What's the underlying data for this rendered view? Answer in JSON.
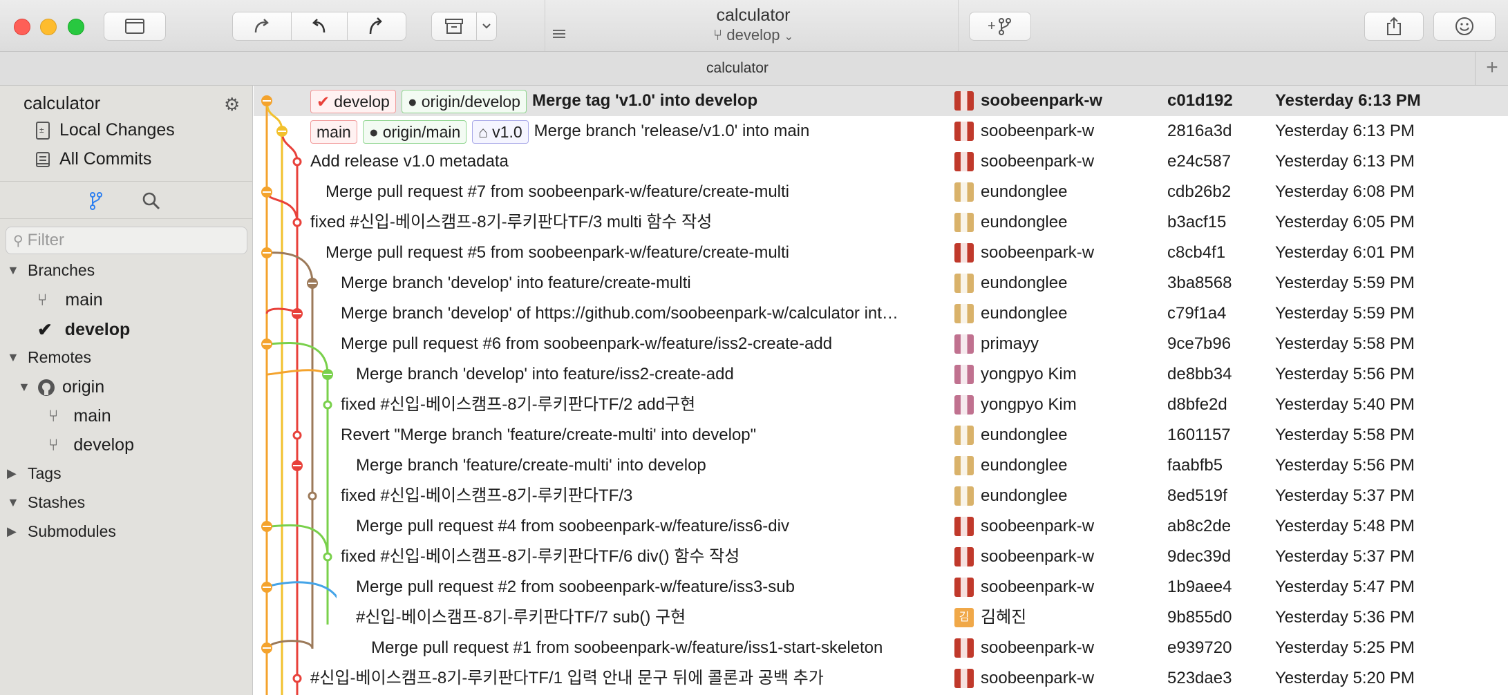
{
  "window": {
    "app_title": "calculator",
    "branch_label": "develop",
    "tab_title": "calculator",
    "tab_plus": "+"
  },
  "sidebar": {
    "repo_name": "calculator",
    "local_changes": "Local Changes",
    "all_commits": "All Commits",
    "filter_placeholder": "Filter",
    "branches_header": "Branches",
    "branches": [
      {
        "label": "main",
        "current": false
      },
      {
        "label": "develop",
        "current": true
      }
    ],
    "remotes_header": "Remotes",
    "remote_name": "origin",
    "remote_branches": [
      "main",
      "develop"
    ],
    "tags_header": "Tags",
    "stashes_header": "Stashes",
    "submodules_header": "Submodules"
  },
  "commits": [
    {
      "message": "Merge tag 'v1.0' into develop",
      "refs": [
        {
          "kind": "local",
          "label": "develop",
          "check": true
        },
        {
          "kind": "remote",
          "label": "origin/develop"
        }
      ],
      "author": "soobeenpark-w",
      "avatar": "red",
      "sha": "c01d192",
      "date": "Yesterday 6:13 PM",
      "selected": true
    },
    {
      "message": "Merge branch 'release/v1.0' into main",
      "refs": [
        {
          "kind": "local",
          "label": "main"
        },
        {
          "kind": "remote",
          "label": "origin/main"
        },
        {
          "kind": "tag",
          "label": "v1.0"
        }
      ],
      "author": "soobeenpark-w",
      "avatar": "red",
      "sha": "2816a3d",
      "date": "Yesterday 6:13 PM"
    },
    {
      "message": "Add release v1.0 metadata",
      "refs": [],
      "author": "soobeenpark-w",
      "avatar": "red",
      "sha": "e24c587",
      "date": "Yesterday 6:13 PM"
    },
    {
      "message": "Merge pull request #7 from soobeenpark-w/feature/create-multi",
      "refs": [],
      "author": "eundonglee",
      "avatar": "tan",
      "sha": "cdb26b2",
      "date": "Yesterday 6:08 PM"
    },
    {
      "message": "fixed #신입-베이스캠프-8기-루키판다TF/3 multi 함수 작성",
      "refs": [],
      "author": "eundonglee",
      "avatar": "tan",
      "sha": "b3acf15",
      "date": "Yesterday 6:05 PM"
    },
    {
      "message": "Merge pull request #5 from soobeenpark-w/feature/create-multi",
      "refs": [],
      "author": "soobeenpark-w",
      "avatar": "red",
      "sha": "c8cb4f1",
      "date": "Yesterday 6:01 PM"
    },
    {
      "message": "Merge branch 'develop' into feature/create-multi",
      "refs": [],
      "author": "eundonglee",
      "avatar": "tan",
      "sha": "3ba8568",
      "date": "Yesterday 5:59 PM"
    },
    {
      "message": "Merge branch 'develop' of https://github.com/soobeenpark-w/calculator int…",
      "refs": [],
      "author": "eundonglee",
      "avatar": "tan",
      "sha": "c79f1a4",
      "date": "Yesterday 5:59 PM"
    },
    {
      "message": "Merge pull request #6 from soobeenpark-w/feature/iss2-create-add",
      "refs": [],
      "author": "primayy",
      "avatar": "pink",
      "sha": "9ce7b96",
      "date": "Yesterday 5:58 PM"
    },
    {
      "message": "Merge branch 'develop' into feature/iss2-create-add",
      "refs": [],
      "author": "yongpyo Kim",
      "avatar": "pink",
      "sha": "de8bb34",
      "date": "Yesterday 5:56 PM"
    },
    {
      "message": "fixed #신입-베이스캠프-8기-루키판다TF/2 add구현",
      "refs": [],
      "author": "yongpyo Kim",
      "avatar": "pink",
      "sha": "d8bfe2d",
      "date": "Yesterday 5:40 PM"
    },
    {
      "message": "Revert \"Merge branch 'feature/create-multi' into develop\"",
      "refs": [],
      "author": "eundonglee",
      "avatar": "tan",
      "sha": "1601157",
      "date": "Yesterday 5:58 PM"
    },
    {
      "message": "Merge branch 'feature/create-multi' into develop",
      "refs": [],
      "author": "eundonglee",
      "avatar": "tan",
      "sha": "faabfb5",
      "date": "Yesterday 5:56 PM"
    },
    {
      "message": "fixed #신입-베이스캠프-8기-루키판다TF/3",
      "refs": [],
      "author": "eundonglee",
      "avatar": "tan",
      "sha": "8ed519f",
      "date": "Yesterday 5:37 PM"
    },
    {
      "message": "Merge pull request #4 from soobeenpark-w/feature/iss6-div",
      "refs": [],
      "author": "soobeenpark-w",
      "avatar": "red",
      "sha": "ab8c2de",
      "date": "Yesterday 5:48 PM"
    },
    {
      "message": "fixed #신입-베이스캠프-8기-루키판다TF/6 div() 함수 작성",
      "refs": [],
      "author": "soobeenpark-w",
      "avatar": "red",
      "sha": "9dec39d",
      "date": "Yesterday 5:37 PM"
    },
    {
      "message": "Merge pull request #2 from soobeenpark-w/feature/iss3-sub",
      "refs": [],
      "author": "soobeenpark-w",
      "avatar": "red",
      "sha": "1b9aee4",
      "date": "Yesterday 5:47 PM"
    },
    {
      "message": "#신입-베이스캠프-8기-루키판다TF/7 sub() 구현",
      "refs": [],
      "author": "김혜진",
      "avatar": "orange",
      "avatar_text": "김",
      "sha": "9b855d0",
      "date": "Yesterday 5:36 PM"
    },
    {
      "message": "Merge pull request #1 from soobeenpark-w/feature/iss1-start-skeleton",
      "refs": [],
      "author": "soobeenpark-w",
      "avatar": "red",
      "sha": "e939720",
      "date": "Yesterday 5:25 PM"
    },
    {
      "message": "#신입-베이스캠프-8기-루키판다TF/1 입력 안내 문구 뒤에 콜론과 공백 추가",
      "refs": [],
      "author": "soobeenpark-w",
      "avatar": "red",
      "sha": "523dae3",
      "date": "Yesterday 5:20 PM"
    }
  ],
  "colors": {
    "lane_orange": "#f4a32d",
    "lane_yellow": "#f2c12e",
    "lane_red": "#e8413a",
    "lane_brown": "#9c7a5a",
    "lane_green": "#79d04b",
    "lane_blue": "#44a4e8",
    "avatar_red": "#c0392b",
    "avatar_tan": "#d9b26a",
    "avatar_pink": "#c0718f",
    "avatar_orange": "#f0a848"
  }
}
